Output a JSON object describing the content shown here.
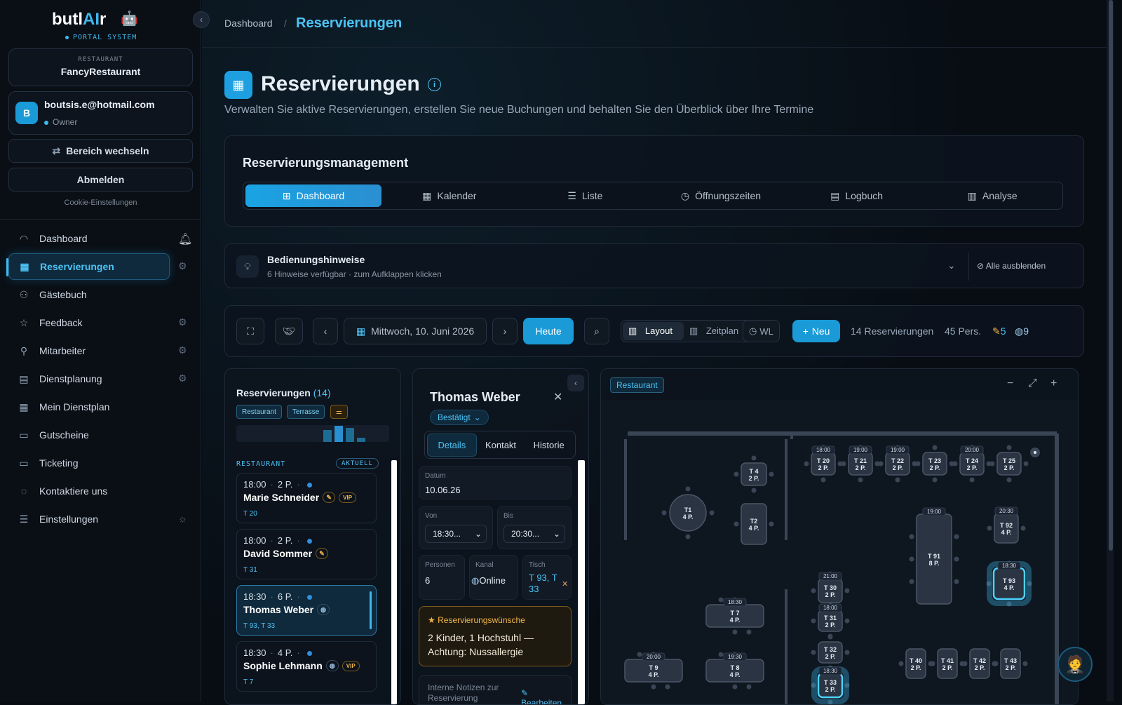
{
  "sidebar": {
    "brand_prefix": "butl",
    "brand_ai": "AI",
    "brand_suffix": "r",
    "brand_sub": "PORTAL SYSTEM",
    "restaurant_label": "RESTAURANT",
    "restaurant_name": "FancyRestaurant",
    "avatar_letter": "B",
    "user_email": "boutsis.e@hotmail.com",
    "user_role": "Owner",
    "switch_label": "Bereich wechseln",
    "logout_label": "Abmelden",
    "cookie_label": "Cookie-Einstellungen",
    "nav": [
      {
        "label": "Dashboard",
        "icon": "gauge-icon"
      },
      {
        "label": "Reservierungen",
        "icon": "calendar-check-icon",
        "active": true
      },
      {
        "label": "Gästebuch",
        "icon": "users-icon"
      },
      {
        "label": "Feedback",
        "icon": "star-icon"
      },
      {
        "label": "Mitarbeiter",
        "icon": "user-icon"
      },
      {
        "label": "Dienstplanung",
        "icon": "clipboard-icon"
      },
      {
        "label": "Mein Dienstplan",
        "icon": "calendar-icon"
      },
      {
        "label": "Gutscheine",
        "icon": "voucher-icon"
      },
      {
        "label": "Ticketing",
        "icon": "ticket-icon"
      },
      {
        "label": "Kontaktiere uns",
        "icon": "chat-icon"
      },
      {
        "label": "Einstellungen",
        "icon": "sliders-icon"
      }
    ]
  },
  "header": {
    "crumb_root": "Dashboard",
    "crumb_sep": "/",
    "crumb_current": "Reservierungen"
  },
  "page": {
    "title": "Reservierungen",
    "description": "Verwalten Sie aktive Reservierungen, erstellen Sie neue Buchungen und behalten Sie den Überblick über Ihre Termine"
  },
  "management": {
    "title": "Reservierungsmanagement",
    "tabs": [
      {
        "label": "Dashboard",
        "icon": "grid-icon"
      },
      {
        "label": "Kalender",
        "icon": "calendar-icon"
      },
      {
        "label": "Liste",
        "icon": "list-icon"
      },
      {
        "label": "Öffnungszeiten",
        "icon": "clock-icon"
      },
      {
        "label": "Logbuch",
        "icon": "book-icon"
      },
      {
        "label": "Analyse",
        "icon": "bar-chart-icon"
      }
    ]
  },
  "hints": {
    "title": "Bedienungshinweise",
    "subtitle": "6 Hinweise verfügbar · zum Aufklappen klicken",
    "hide_all": "Alle ausblenden"
  },
  "toolbar": {
    "date": "Mittwoch, 10. Juni 2026",
    "today": "Heute",
    "layout": "Layout",
    "schedule": "Zeitplan",
    "wl": "WL",
    "new": "Neu",
    "res_count": "14 Reservierungen",
    "persons": "45 Pers.",
    "pen_count": "5",
    "online_count": "9"
  },
  "res_list": {
    "title": "Reservierungen",
    "count": "(14)",
    "chips": [
      "Restaurant",
      "Terrasse"
    ],
    "histogram": [
      0.7,
      0.95,
      0.85,
      0.25
    ],
    "section": "RESTAURANT",
    "current": "AKTUELL",
    "items": [
      {
        "time": "18:00",
        "persons": "2 P.",
        "name": "Marie Schneider",
        "tables": "T 20",
        "pen": true,
        "vip": "VIP"
      },
      {
        "time": "18:00",
        "persons": "2 P.",
        "name": "David Sommer",
        "tables": "T 31",
        "pen": true
      },
      {
        "time": "18:30",
        "persons": "6 P.",
        "name": "Thomas Weber",
        "tables": "T 93, T 33",
        "globe": true,
        "selected": true
      },
      {
        "time": "18:30",
        "persons": "4 P.",
        "name": "Sophie Lehmann",
        "tables": "T 7",
        "globe": true,
        "vip": "VIP"
      }
    ]
  },
  "details": {
    "name": "Thomas Weber",
    "status": "Bestätigt",
    "tabs": [
      "Details",
      "Kontakt",
      "Historie"
    ],
    "date_label": "Datum",
    "date": "10.06.26",
    "from_label": "Von",
    "from": "18:30...",
    "to_label": "Bis",
    "to": "20:30...",
    "persons_label": "Personen",
    "persons": "6",
    "channel_label": "Kanal",
    "channel": "Online",
    "table_label": "Tisch",
    "table": "T 93, T 33",
    "wish_title": "Reservierungswünsche",
    "wish_text": "2 Kinder, 1 Hochstuhl — Achtung: Nussallergie",
    "notes_placeholder": "Interne Notizen zur Reservierung",
    "edit": "Bearbeiten"
  },
  "floor": {
    "area": "Restaurant",
    "tables": [
      {
        "id": "T1",
        "seats": "4 P."
      },
      {
        "id": "T 4",
        "seats": "2 P."
      },
      {
        "id": "T2",
        "seats": "4 P."
      },
      {
        "id": "T 20",
        "seats": "2 P.",
        "time": "18:00"
      },
      {
        "id": "T 21",
        "seats": "2 P.",
        "time": "19:00"
      },
      {
        "id": "T 22",
        "seats": "2 P.",
        "time": "19:00"
      },
      {
        "id": "T 23",
        "seats": "2 P."
      },
      {
        "id": "T 24",
        "seats": "2 P.",
        "time": "20:00"
      },
      {
        "id": "T 25",
        "seats": "2 P."
      },
      {
        "id": "T 92",
        "seats": "4 P.",
        "time": "20:30"
      },
      {
        "id": "T 91",
        "seats": "8 P.",
        "time": "19:00"
      },
      {
        "id": "T 93",
        "seats": "4 P.",
        "time": "18:30"
      },
      {
        "id": "T 30",
        "seats": "2 P.",
        "time": "21:00"
      },
      {
        "id": "T 31",
        "seats": "2 P.",
        "time": "18:00"
      },
      {
        "id": "T 32",
        "seats": "2 P."
      },
      {
        "id": "T 33",
        "seats": "2 P.",
        "time": "18:30"
      },
      {
        "id": "T 7",
        "seats": "4 P.",
        "time": "18:30"
      },
      {
        "id": "T 9",
        "seats": "4 P.",
        "time": "20:00"
      },
      {
        "id": "T 8",
        "seats": "4 P.",
        "time": "19:30"
      },
      {
        "id": "T 40",
        "seats": "2 P."
      },
      {
        "id": "T 41",
        "seats": "2 P."
      },
      {
        "id": "T 42",
        "seats": "2 P."
      },
      {
        "id": "T 43",
        "seats": "2 P."
      }
    ]
  },
  "colors": {
    "accent": "#3fb8ee",
    "warn": "#f0b64a",
    "bg": "#080d14"
  }
}
